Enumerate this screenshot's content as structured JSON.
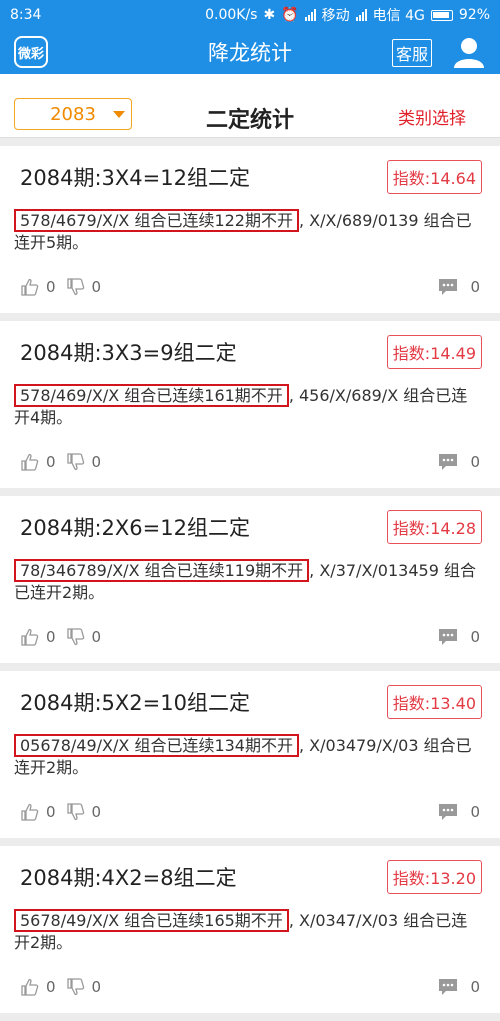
{
  "status_bar": {
    "time": "8:34",
    "speed": "0.00K/s",
    "carrier1": "移动",
    "carrier2": "电信 4G",
    "battery": "92%"
  },
  "app_bar": {
    "logo_text": "微彩",
    "title": "降龙统计",
    "service_label": "客服"
  },
  "toolbar": {
    "period_select": "2083",
    "page_title": "二定统计",
    "category_select": "类别选择"
  },
  "cards": [
    {
      "title": "2084期:3X4=12组二定",
      "badge": "指数:14.64",
      "highlight": "578/4679/X/X 组合已连续122期不开",
      "rest": ", X/X/689/0139 组合已连开5期。",
      "likes": "0",
      "dislikes": "0",
      "comments": "0"
    },
    {
      "title": "2084期:3X3=9组二定",
      "badge": "指数:14.49",
      "highlight": "578/469/X/X 组合已连续161期不开",
      "rest": ", 456/X/689/X 组合已连开4期。",
      "likes": "0",
      "dislikes": "0",
      "comments": "0"
    },
    {
      "title": "2084期:2X6=12组二定",
      "badge": "指数:14.28",
      "highlight": "78/346789/X/X 组合已连续119期不开",
      "rest": ", X/37/X/013459 组合已连开2期。",
      "likes": "0",
      "dislikes": "0",
      "comments": "0"
    },
    {
      "title": "2084期:5X2=10组二定",
      "badge": "指数:13.40",
      "highlight": "05678/49/X/X 组合已连续134期不开",
      "rest": ", X/03479/X/03 组合已连开2期。",
      "likes": "0",
      "dislikes": "0",
      "comments": "0"
    },
    {
      "title": "2084期:4X2=8组二定",
      "badge": "指数:13.20",
      "highlight": "5678/49/X/X 组合已连续165期不开",
      "rest": ", X/0347/X/03 组合已连开2期。",
      "likes": "0",
      "dislikes": "0",
      "comments": "0"
    }
  ],
  "colors": {
    "primary": "#1f8fe6",
    "accent_orange": "#f08a00",
    "accent_red": "#e0202a"
  }
}
